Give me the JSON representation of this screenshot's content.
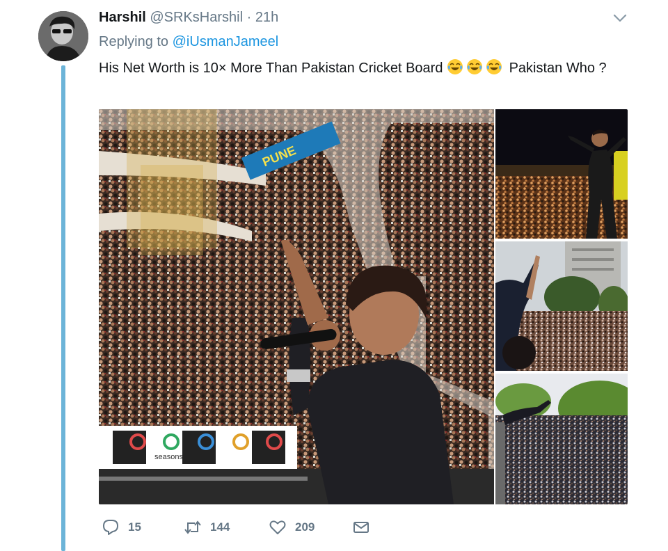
{
  "tweet": {
    "display_name": "Harshil",
    "handle": "@SRKsHarshil",
    "separator": "·",
    "time": "21h",
    "replying_prefix": "Replying to",
    "replying_handle": "@iUsmanJameel",
    "text_before_emoji": "His Net Worth is 10× More Than Pakistan Cricket Board",
    "emoji": [
      "face-with-tears-of-joy",
      "face-with-tears-of-joy",
      "face-with-tears-of-joy"
    ],
    "text_after_emoji": "Pakistan Who ?",
    "photos": [
      {
        "id": "main-photo",
        "overlay_texts": [
          "PUNE",
          "seasons"
        ]
      },
      {
        "id": "top-right-photo",
        "overlay_texts": []
      },
      {
        "id": "middle-right-photo",
        "overlay_texts": []
      },
      {
        "id": "bottom-right-photo",
        "overlay_texts": []
      }
    ]
  },
  "actions": {
    "reply_count": "15",
    "retweet_count": "144",
    "like_count": "209"
  },
  "colors": {
    "name": "#14171a",
    "meta": "#657786",
    "link": "#1b95e0",
    "thread_line": "#6cb4d8"
  },
  "icons": [
    "chevron-down-icon",
    "reply-icon",
    "retweet-icon",
    "heart-icon",
    "envelope-icon"
  ]
}
